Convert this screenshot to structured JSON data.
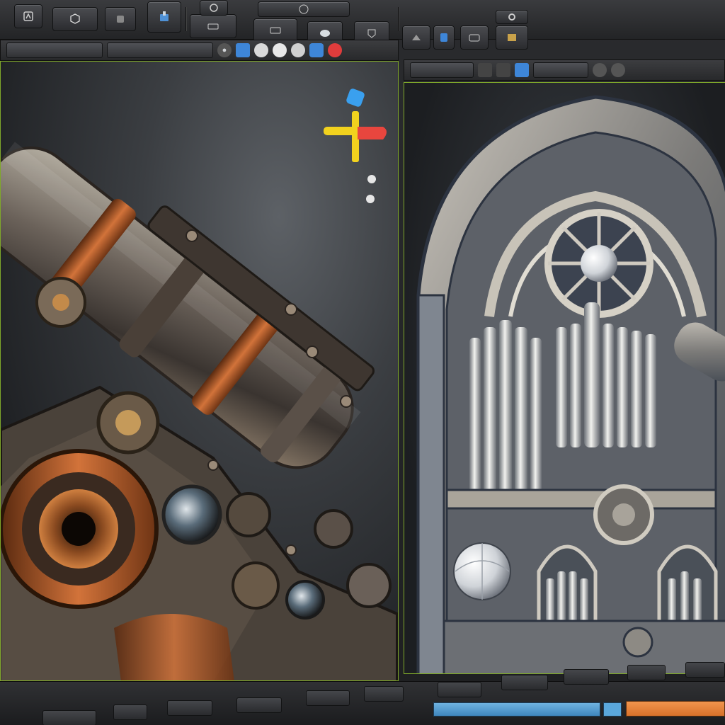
{
  "toolbar": {
    "buttons": [
      {
        "label": "",
        "icon": "hand-icon"
      },
      {
        "label": "",
        "icon": "cube-icon"
      },
      {
        "label": "",
        "icon": "dots-icon"
      },
      {
        "label": "",
        "icon": "paint-icon"
      },
      {
        "label": "",
        "icon": "snapshot-icon"
      },
      {
        "label": "",
        "icon": "tools-icon"
      },
      {
        "label": "",
        "icon": "sphere-icon"
      },
      {
        "label": "",
        "icon": "frame-icon"
      },
      {
        "label": "",
        "icon": "shield-icon"
      },
      {
        "label": "",
        "icon": "globe-icon"
      },
      {
        "label": "",
        "icon": "scene-icon"
      },
      {
        "label": "",
        "icon": "bolt-icon"
      }
    ]
  },
  "left_panel": {
    "icons": [
      "target-icon",
      "gear-icon",
      "layers-icon"
    ],
    "accent_colors": [
      "#3e86d8",
      "#e03c3c"
    ]
  },
  "right_panel": {
    "icons": [
      "gear-icon",
      "cube-icon"
    ],
    "accent_color": "#3e86d8"
  },
  "gizmo": {
    "x_color": "#e8463e",
    "y_color": "#f2d21e",
    "z_color": "#3aa0ef"
  },
  "status": {
    "blue_bar_color": "#5aa7db",
    "orange_bar_color": "#e88040"
  }
}
